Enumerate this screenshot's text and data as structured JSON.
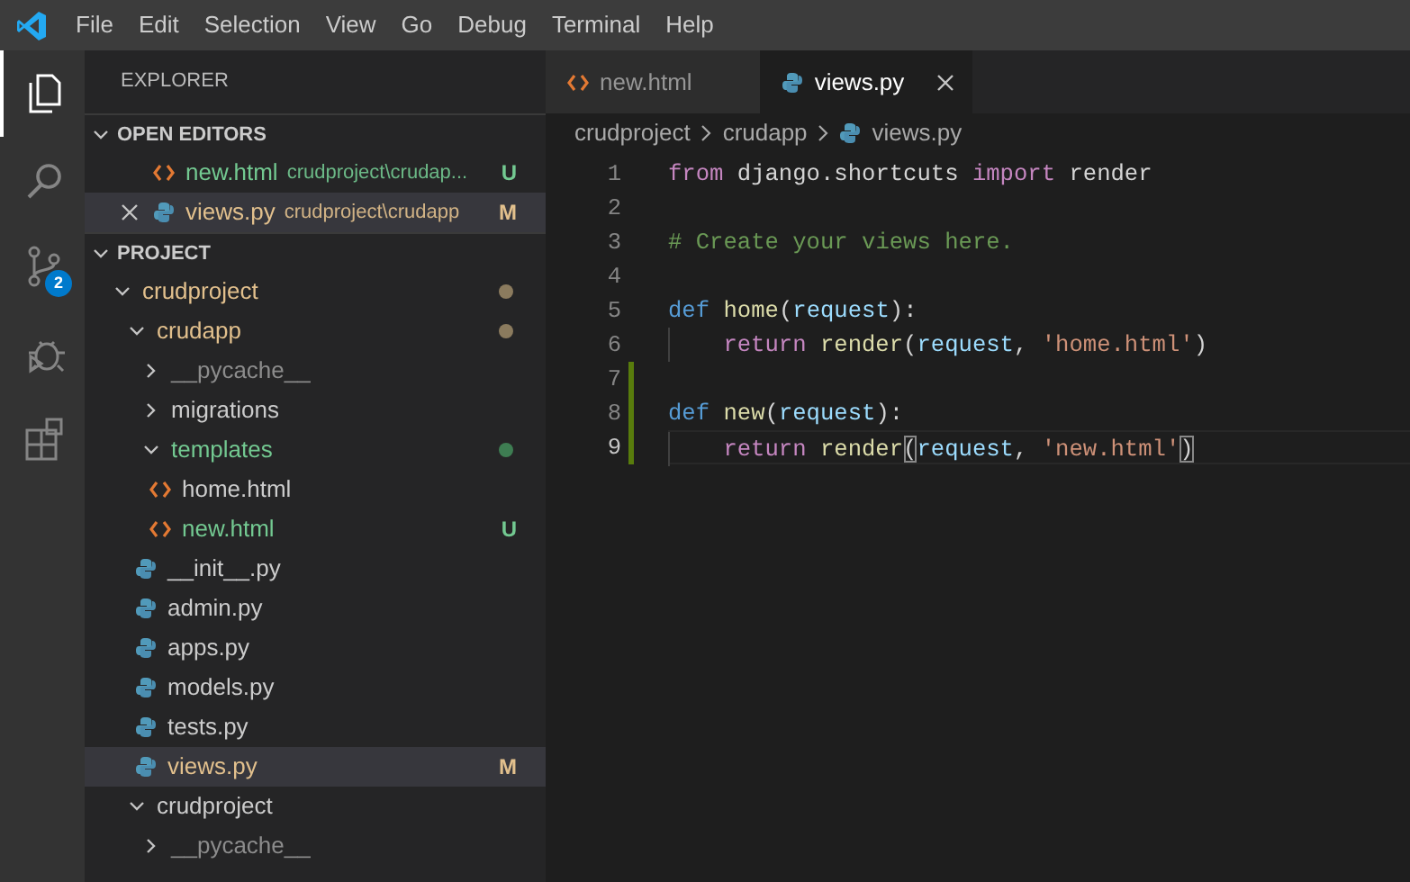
{
  "menu": [
    "File",
    "Edit",
    "Selection",
    "View",
    "Go",
    "Debug",
    "Terminal",
    "Help"
  ],
  "activity_bar": [
    {
      "kind": "files",
      "selected": true
    },
    {
      "kind": "search",
      "selected": false
    },
    {
      "kind": "source-control",
      "selected": false,
      "badge": "2"
    },
    {
      "kind": "debug",
      "selected": false
    },
    {
      "kind": "extensions",
      "selected": false
    }
  ],
  "sidebar": {
    "title": "EXPLORER",
    "open_editors": {
      "label": "OPEN EDITORS",
      "expanded": true,
      "items": [
        {
          "name": "new.html",
          "kind": "html",
          "path": "crudproject\\crudap...",
          "color": "#73c991",
          "badge": "U",
          "selected": false
        },
        {
          "name": "views.py",
          "kind": "python",
          "path": "crudproject\\crudapp",
          "color": "#e2c08d",
          "badge": "M",
          "selected": true
        }
      ]
    },
    "project": {
      "label": "PROJECT",
      "expanded": true,
      "tree": [
        {
          "name": "crudproject",
          "kind": "folder",
          "expanded": true,
          "color": "#e2c08d",
          "status_dot": {
            "color": "#8b7b5e"
          },
          "children": [
            {
              "name": "crudapp",
              "kind": "folder",
              "expanded": true,
              "color": "#e2c08d",
              "status_dot": {
                "color": "#8b7b5e"
              },
              "children": [
                {
                  "name": "__pycache__",
                  "kind": "folder",
                  "expanded": false,
                  "color": "#8c8c8c"
                },
                {
                  "name": "migrations",
                  "kind": "folder",
                  "expanded": false,
                  "color": "#cccccc"
                },
                {
                  "name": "templates",
                  "kind": "folder",
                  "expanded": true,
                  "color": "#73c991",
                  "status_dot": {
                    "color": "#3e7d52"
                  },
                  "children": [
                    {
                      "name": "home.html",
                      "kind": "html",
                      "color": "#cccccc"
                    },
                    {
                      "name": "new.html",
                      "kind": "html",
                      "color": "#73c991",
                      "badge": "U"
                    }
                  ]
                },
                {
                  "name": "__init__.py",
                  "kind": "python",
                  "color": "#cccccc"
                },
                {
                  "name": "admin.py",
                  "kind": "python",
                  "color": "#cccccc"
                },
                {
                  "name": "apps.py",
                  "kind": "python",
                  "color": "#cccccc"
                },
                {
                  "name": "models.py",
                  "kind": "python",
                  "color": "#cccccc"
                },
                {
                  "name": "tests.py",
                  "kind": "python",
                  "color": "#cccccc"
                },
                {
                  "name": "views.py",
                  "kind": "python",
                  "color": "#e2c08d",
                  "badge": "M",
                  "selected": true
                }
              ]
            },
            {
              "name": "crudproject",
              "kind": "folder",
              "expanded": true,
              "color": "#cccccc",
              "children": [
                {
                  "name": "__pycache__",
                  "kind": "folder",
                  "expanded": false,
                  "color": "#8c8c8c"
                }
              ]
            }
          ]
        }
      ]
    }
  },
  "tabs": [
    {
      "label": "new.html",
      "kind": "html",
      "selected": false
    },
    {
      "label": "views.py",
      "kind": "python",
      "selected": true
    }
  ],
  "breadcrumb": [
    {
      "label": "crudproject",
      "kind": "folder"
    },
    {
      "label": "crudapp",
      "kind": "folder"
    },
    {
      "label": "views.py",
      "kind": "python"
    }
  ],
  "code": [
    {
      "number": "1",
      "changed": false,
      "current": false,
      "indented": false,
      "tokens": [
        {
          "text": "from",
          "kind": "keyword"
        },
        {
          "text": " django.shortcuts ",
          "kind": "plain"
        },
        {
          "text": "import",
          "kind": "keyword"
        },
        {
          "text": " render",
          "kind": "plain"
        }
      ]
    },
    {
      "number": "2",
      "changed": false,
      "current": false,
      "indented": false
    },
    {
      "number": "3",
      "changed": false,
      "current": false,
      "indented": false,
      "tokens": [
        {
          "text": "# Create your views here.",
          "kind": "comment"
        }
      ]
    },
    {
      "number": "4",
      "changed": false,
      "current": false,
      "indented": false
    },
    {
      "number": "5",
      "changed": false,
      "current": false,
      "indented": false,
      "tokens": [
        {
          "text": "def",
          "kind": "def"
        },
        {
          "text": " home",
          "kind": "func"
        },
        {
          "text": "(",
          "kind": "plain"
        },
        {
          "text": "request",
          "kind": "param"
        },
        {
          "text": "):",
          "kind": "plain"
        }
      ]
    },
    {
      "number": "6",
      "changed": false,
      "current": false,
      "indented": true,
      "tokens": [
        {
          "text": "return",
          "kind": "keyword"
        },
        {
          "text": " render",
          "kind": "func"
        },
        {
          "text": "(",
          "kind": "plain"
        },
        {
          "text": "request",
          "kind": "param"
        },
        {
          "text": ", ",
          "kind": "plain"
        },
        {
          "text": "'home.html'",
          "kind": "string"
        },
        {
          "text": ")",
          "kind": "plain"
        }
      ]
    },
    {
      "number": "7",
      "changed": true,
      "current": false,
      "indented": false
    },
    {
      "number": "8",
      "changed": true,
      "current": false,
      "indented": false,
      "tokens": [
        {
          "text": "def",
          "kind": "def"
        },
        {
          "text": " new",
          "kind": "func"
        },
        {
          "text": "(",
          "kind": "plain"
        },
        {
          "text": "request",
          "kind": "param"
        },
        {
          "text": "):",
          "kind": "plain"
        }
      ]
    },
    {
      "number": "9",
      "changed": true,
      "current": true,
      "indented": true,
      "tokens": [
        {
          "text": "return",
          "kind": "keyword"
        },
        {
          "text": " render",
          "kind": "func"
        },
        {
          "text": "(",
          "kind": "matched"
        },
        {
          "text": "request",
          "kind": "param"
        },
        {
          "text": ", ",
          "kind": "plain"
        },
        {
          "text": "'new.html'",
          "kind": "string"
        },
        {
          "text": ")",
          "kind": "matched"
        }
      ]
    }
  ]
}
